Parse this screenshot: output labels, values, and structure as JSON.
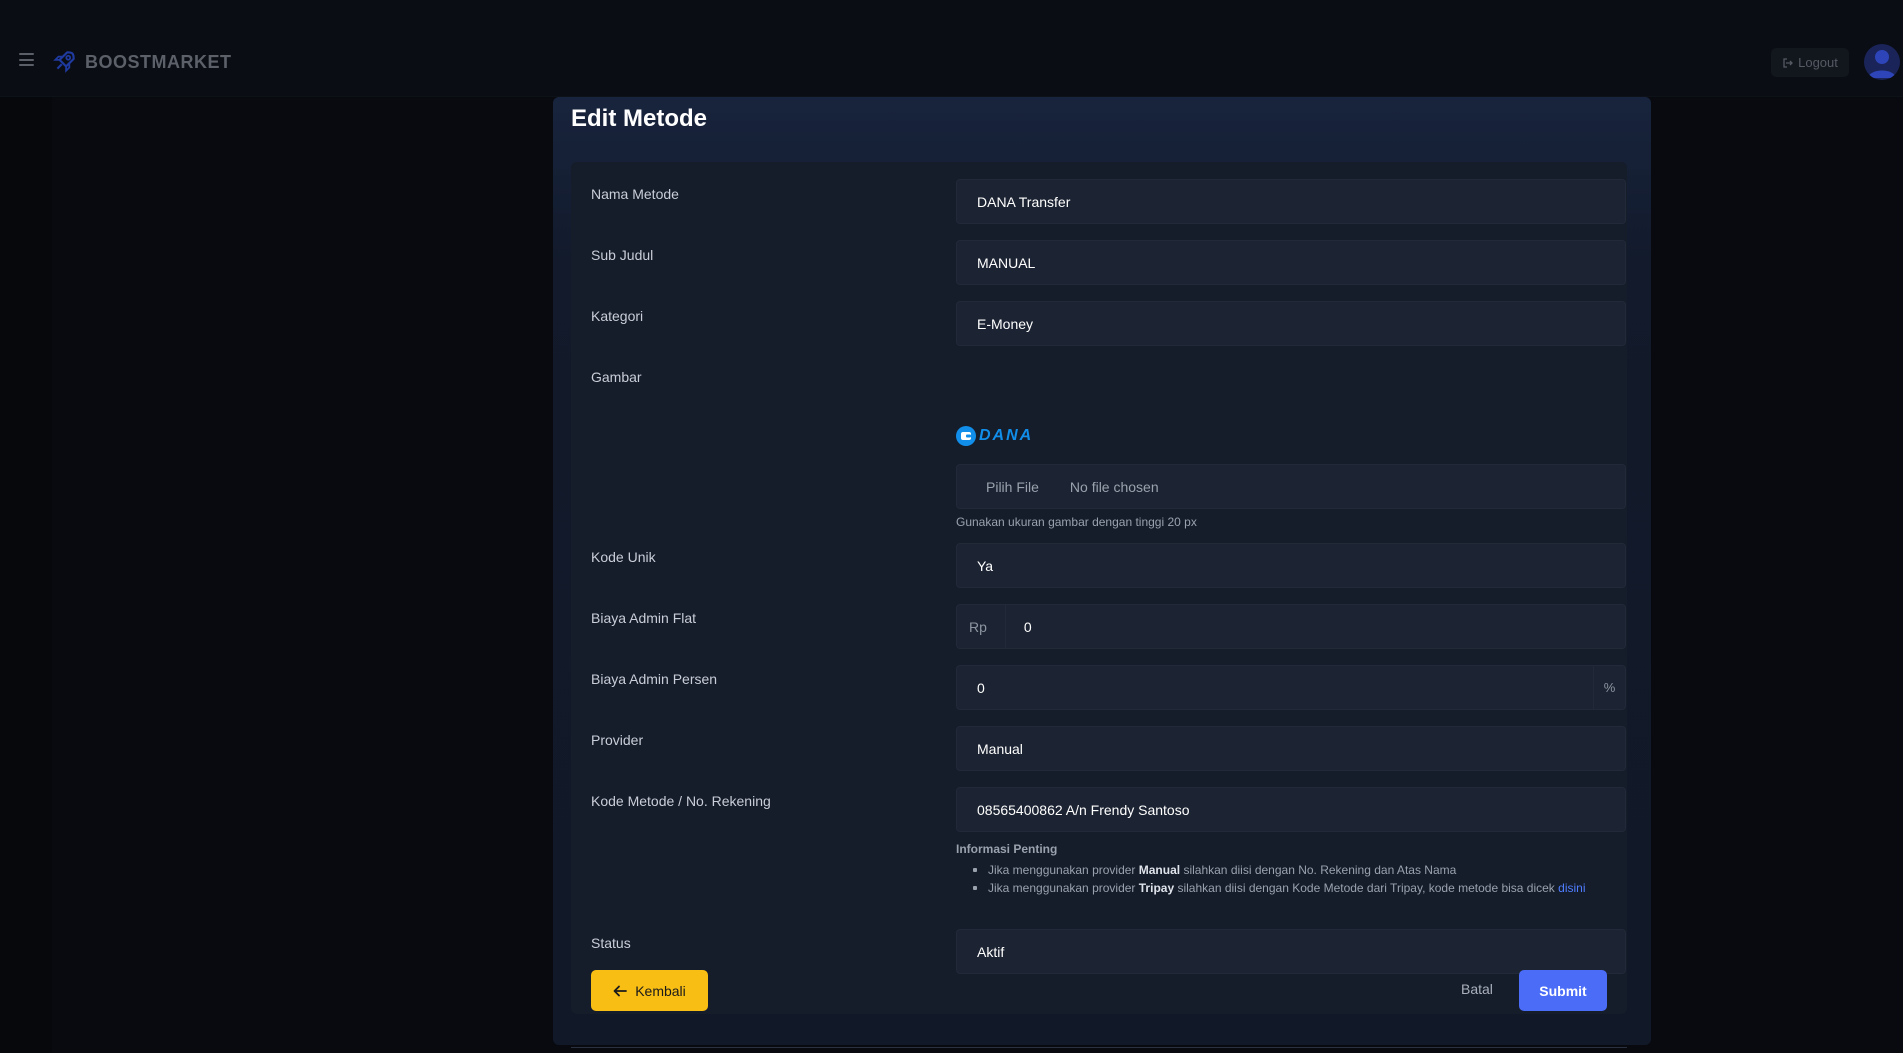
{
  "navbar": {
    "brand": "BOOSTMARKET",
    "logout_label": "Logout"
  },
  "modal": {
    "title": "Edit Metode"
  },
  "form": {
    "nama_metode": {
      "label": "Nama Metode",
      "value": "DANA Transfer"
    },
    "sub_judul": {
      "label": "Sub Judul",
      "value": "MANUAL"
    },
    "kategori": {
      "label": "Kategori",
      "value": "E-Money"
    },
    "gambar": {
      "label": "Gambar",
      "logo_text": "DANA",
      "file_button": "Pilih File",
      "file_status": "No file chosen",
      "help": "Gunakan ukuran gambar dengan tinggi 20 px"
    },
    "kode_unik": {
      "label": "Kode Unik",
      "value": "Ya"
    },
    "biaya_admin_flat": {
      "label": "Biaya Admin Flat",
      "prefix": "Rp",
      "value": "0"
    },
    "biaya_admin_persen": {
      "label": "Biaya Admin Persen",
      "value": "0",
      "suffix": "%"
    },
    "provider": {
      "label": "Provider",
      "value": "Manual"
    },
    "kode_metode": {
      "label": "Kode Metode / No. Rekening",
      "value": "08565400862 A/n Frendy Santoso"
    },
    "info": {
      "title": "Informasi Penting",
      "item1_pre": "Jika menggunakan provider",
      "item1_bold": "Manual",
      "item1_post": "silahkan diisi dengan No. Rekening dan Atas Nama",
      "item2_pre": "Jika menggunakan provider",
      "item2_bold": "Tripay",
      "item2_post": "silahkan diisi dengan Kode Metode dari Tripay, kode metode bisa dicek",
      "item2_link": "disini"
    },
    "status": {
      "label": "Status",
      "value": "Aktif"
    }
  },
  "footer": {
    "back_label": "Kembali",
    "cancel_label": "Batal",
    "submit_label": "Submit"
  },
  "colors": {
    "accent": "#4a6cf7",
    "back_button": "#f9be14",
    "dana_blue": "#118eea"
  }
}
